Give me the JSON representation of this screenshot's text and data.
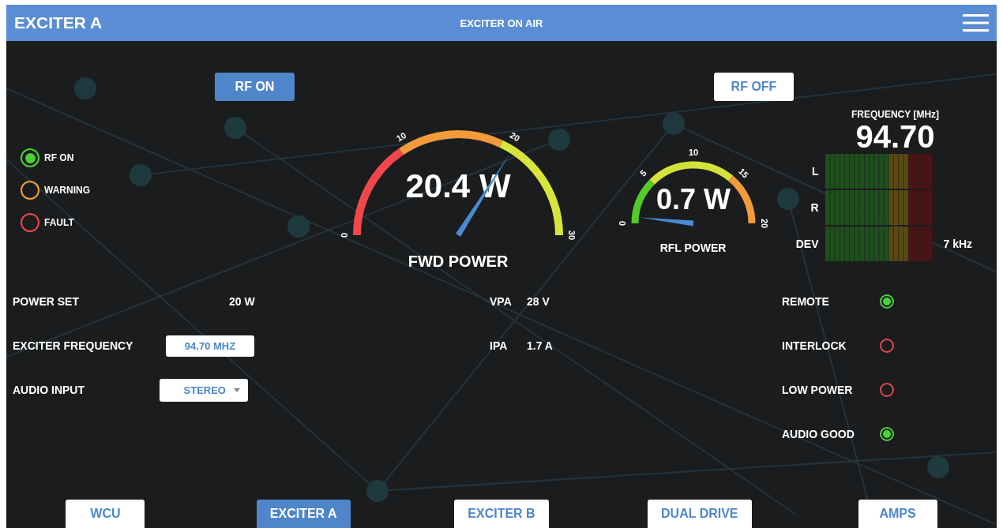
{
  "header": {
    "title": "EXCITER A",
    "status": "EXCITER ON AIR"
  },
  "rf_buttons": [
    {
      "label": "RF ON",
      "selected": true
    },
    {
      "label": "RF OFF",
      "selected": false
    }
  ],
  "status_lights": [
    {
      "label": "RF ON",
      "color": "#4cd137",
      "on": true
    },
    {
      "label": "WARNING",
      "color": "#f0a030",
      "on": false
    },
    {
      "label": "FAULT",
      "color": "#e8484e",
      "on": false
    }
  ],
  "gauges": [
    {
      "kind": "forward",
      "reading": "20.4 W",
      "title": "FWD POWER",
      "ticks": [
        "0",
        "10",
        "20",
        "30"
      ]
    },
    {
      "kind": "reflected",
      "reading": "0.7 W",
      "title": "RFL POWER",
      "ticks": [
        "0",
        "5",
        "10",
        "15",
        "20"
      ]
    }
  ],
  "frequency": {
    "label": "FREQUENCY [MHz]",
    "value": "94.70",
    "meters": [
      {
        "label": "L"
      },
      {
        "label": "R"
      },
      {
        "label": "DEV",
        "reading": "7 kHz"
      }
    ]
  },
  "settings": [
    {
      "kind": "text",
      "label": "POWER SET",
      "value": "20 W"
    },
    {
      "kind": "field",
      "label": "EXCITER FREQUENCY",
      "value": "94.70 MHZ"
    },
    {
      "kind": "dropdown",
      "label": "AUDIO INPUT",
      "value": "STEREO"
    }
  ],
  "readings": [
    {
      "label": "VPA",
      "value": "28 V"
    },
    {
      "label": "IPA",
      "value": "1.7 A"
    }
  ],
  "indicators": [
    {
      "label": "REMOTE",
      "color": "#4cd137",
      "on": true
    },
    {
      "label": "INTERLOCK",
      "color": "#e8484e",
      "on": false
    },
    {
      "label": "LOW POWER",
      "color": "#e8484e",
      "on": false
    },
    {
      "label": "AUDIO GOOD",
      "color": "#4cd137",
      "on": true
    }
  ],
  "nav": [
    {
      "label": "WCU",
      "selected": false
    },
    {
      "label": "EXCITER A",
      "selected": true
    },
    {
      "label": "EXCITER B",
      "selected": false
    },
    {
      "label": "DUAL DRIVE",
      "selected": false
    },
    {
      "label": "AMPS",
      "selected": false
    }
  ]
}
